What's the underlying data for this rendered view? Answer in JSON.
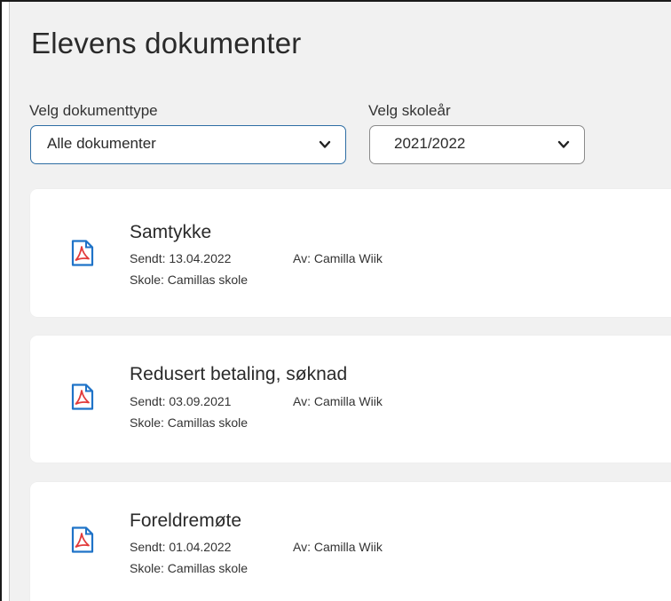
{
  "page": {
    "title": "Elevens dokumenter"
  },
  "filters": {
    "doc_type": {
      "label": "Velg dokumenttype",
      "value": "Alle dokumenter"
    },
    "school_year": {
      "label": "Velg skoleår",
      "value": "2021/2022"
    }
  },
  "documents": [
    {
      "icon": "pdf-icon",
      "title": "Samtykke",
      "sent": "Sendt: 13.04.2022",
      "author": "Av: Camilla Wiik",
      "school": "Skole: Camillas skole"
    },
    {
      "icon": "pdf-icon",
      "title": "Redusert betaling, søknad",
      "sent": "Sendt: 03.09.2021",
      "author": "Av: Camilla Wiik",
      "school": "Skole: Camillas skole"
    },
    {
      "icon": "pdf-icon",
      "title": "Foreldremøte",
      "sent": "Sendt: 01.04.2022",
      "author": "Av: Camilla Wiik",
      "school": "Skole: Camillas skole"
    }
  ],
  "colors": {
    "panel_bg": "#f1f1f1",
    "card_bg": "#ffffff",
    "active_border": "#2d6da3",
    "pdf_icon": "#1f73c8",
    "text": "#2a2a2a"
  }
}
